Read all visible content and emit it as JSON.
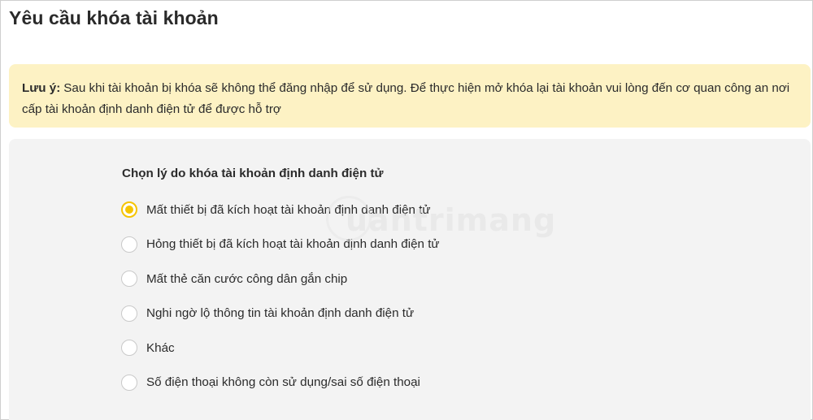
{
  "page": {
    "title": "Yêu cầu khóa tài khoản"
  },
  "notice": {
    "label": "Lưu ý:",
    "text": "Sau khi tài khoản bị khóa sẽ không thể đăng nhập để sử dụng. Để thực hiện mở khóa lại tài khoản vui lòng đến cơ quan công an nơi cấp tài khoản định danh điện tử để được hỗ trợ",
    "background_color": "#fdf2c4"
  },
  "form": {
    "title": "Chọn lý do khóa tài khoản định danh điện tử",
    "selected_index": 0,
    "accent_color": "#f5c400",
    "options": [
      {
        "label": "Mất thiết bị đã kích hoạt tài khoản định danh điện tử"
      },
      {
        "label": "Hỏng thiết bị đã kích hoạt tài khoản định danh điện tử"
      },
      {
        "label": "Mất thẻ căn cước công dân gắn chip"
      },
      {
        "label": "Nghi ngờ lộ thông tin tài khoản định danh điện tử"
      },
      {
        "label": "Khác"
      },
      {
        "label": "Số điện thoại không còn sử dụng/sai số điện thoại"
      }
    ]
  },
  "watermark": {
    "text": "uantrimang"
  }
}
